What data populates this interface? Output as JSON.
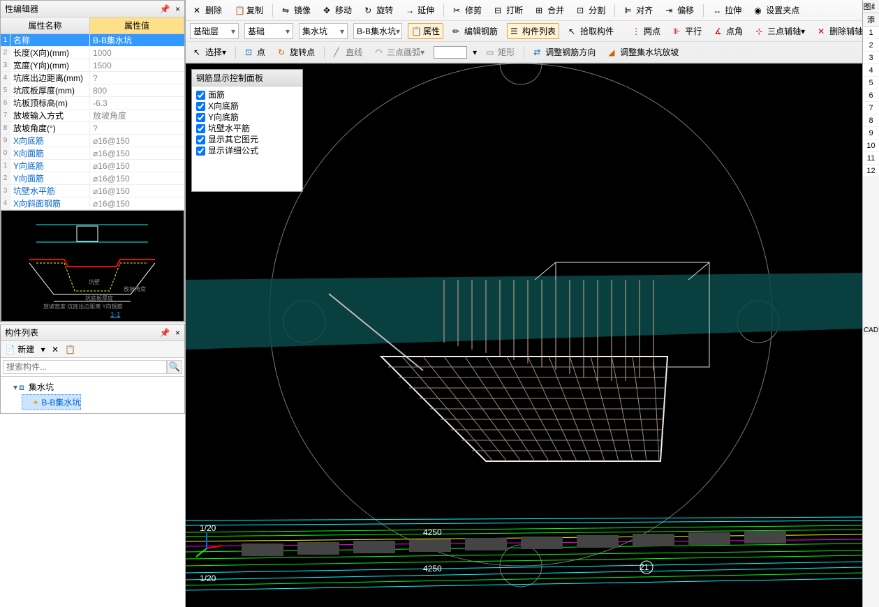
{
  "propEditor": {
    "title": "性编辑器",
    "header": {
      "name": "属性名称",
      "value": "属性值"
    },
    "rows": [
      {
        "idx": "1",
        "name": "名称",
        "value": "B-B集水坑",
        "selected": true
      },
      {
        "idx": "2",
        "name": "长度(X向)(mm)",
        "value": "1000"
      },
      {
        "idx": "3",
        "name": "宽度(Y向)(mm)",
        "value": "1500"
      },
      {
        "idx": "4",
        "name": "坑底出边距离(mm)",
        "value": "?"
      },
      {
        "idx": "5",
        "name": "坑底板厚度(mm)",
        "value": "800"
      },
      {
        "idx": "6",
        "name": "坑板顶标高(m)",
        "value": "-6.3"
      },
      {
        "idx": "7",
        "name": "放坡输入方式",
        "value": "放坡角度"
      },
      {
        "idx": "8",
        "name": "放坡角度(°)",
        "value": "?"
      },
      {
        "idx": "9",
        "name": "X向底筋",
        "value": "⌀16@150",
        "link": true
      },
      {
        "idx": "0",
        "name": "X向面筋",
        "value": "⌀16@150",
        "link": true
      },
      {
        "idx": "1",
        "name": "Y向底筋",
        "value": "⌀16@150",
        "link": true
      },
      {
        "idx": "2",
        "name": "Y向面筋",
        "value": "⌀16@150",
        "link": true
      },
      {
        "idx": "3",
        "name": "坑壁水平筋",
        "value": "⌀16@150",
        "link": true
      },
      {
        "idx": "4",
        "name": "X向斜面钢筋",
        "value": "⌀16@150",
        "link": true
      }
    ],
    "previewLink": "1-1"
  },
  "componentList": {
    "title": "构件列表",
    "new": "新建",
    "searchPlaceholder": "搜索构件...",
    "root": "集水坑",
    "child": "B-B集水坑"
  },
  "ribbon": {
    "row1": [
      "删除",
      "复制",
      "镜像",
      "移动",
      "旋转",
      "延伸",
      "修剪",
      "打断",
      "合并",
      "分割",
      "对齐",
      "偏移",
      "拉伸",
      "设置夹点"
    ],
    "row2": {
      "layer": "基础层",
      "category": "基础",
      "type": "集水坑",
      "name": "B-B集水坑",
      "attrib": "属性",
      "editRebar": "编辑钢筋",
      "compList": "构件列表",
      "pick": "拾取构件",
      "twoPoint": "两点",
      "parallel": "平行",
      "angle": "点角",
      "threePoint": "三点辅轴",
      "delAxis": "删除辅轴"
    },
    "row3": {
      "select": "选择",
      "point": "点",
      "rotPoint": "旋转点",
      "line": "直线",
      "arc": "三点画弧",
      "rect": "矩形",
      "adjustDir": "调整钢筋方向",
      "adjustSlope": "调整集水坑放坡"
    }
  },
  "floatPanel": {
    "title": "钢筋显示控制面板",
    "items": [
      "面筋",
      "X向底筋",
      "Y向底筋",
      "坑壁水平筋",
      "显示其它图元",
      "显示详细公式"
    ]
  },
  "rightStrip": {
    "top1": "图纟",
    "top2": "添",
    "nums": [
      "1",
      "2",
      "3",
      "4",
      "5",
      "6",
      "7",
      "8",
      "9",
      "10",
      "11",
      "12"
    ],
    "cad": "CAD"
  },
  "viewport": {
    "dims": [
      "4250",
      "4250",
      "1/20",
      "1/20",
      "21"
    ]
  }
}
